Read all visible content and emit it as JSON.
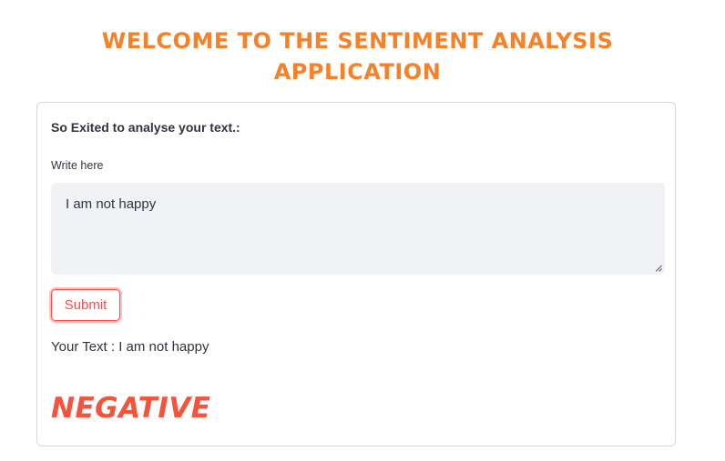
{
  "header": {
    "title_line1": "WELCOME TO THE SENTIMENT ANALYSIS",
    "title_line2": "APPLICATION",
    "color": "#f5822a"
  },
  "form": {
    "heading": "So Exited to analyse your text.:",
    "textarea_label": "Write here",
    "textarea_value": "I am not happy",
    "submit_label": "Submit",
    "accent_color": "#ff4b4b"
  },
  "output": {
    "your_text": "Your Text : I am not happy",
    "sentiment": "NEGATIVE",
    "sentiment_color": "#f4533c"
  }
}
